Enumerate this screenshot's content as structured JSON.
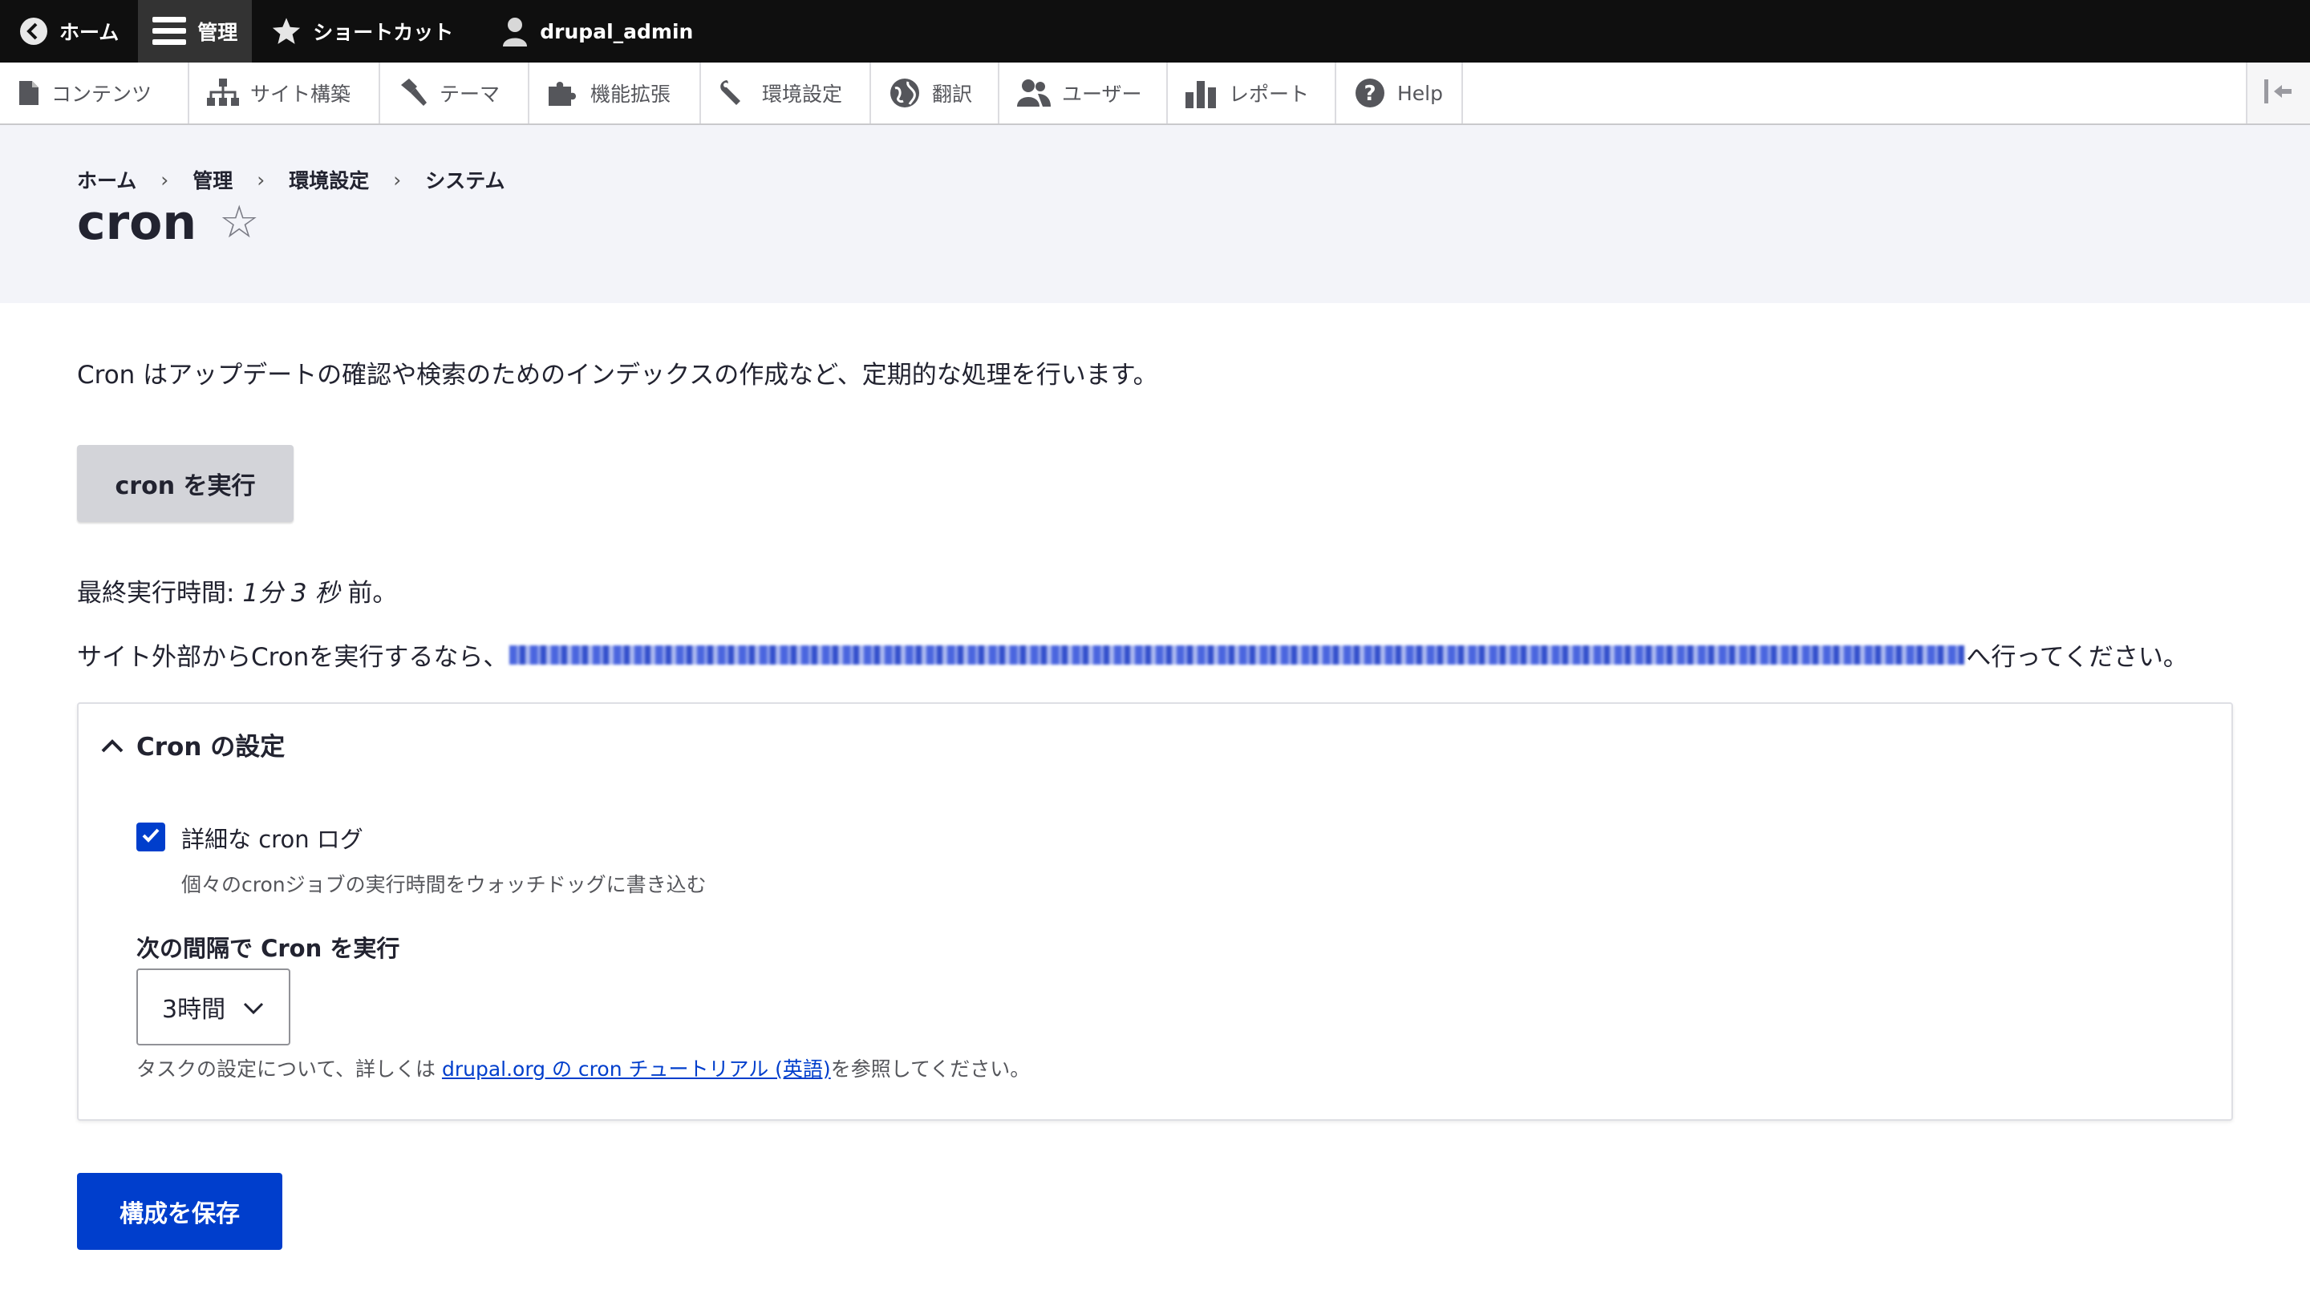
{
  "toolbar": {
    "home": "ホーム",
    "manage": "管理",
    "shortcuts": "ショートカット",
    "user": "drupal_admin"
  },
  "tray": {
    "items": [
      {
        "label": "コンテンツ",
        "icon": "file-icon"
      },
      {
        "label": "サイト構築",
        "icon": "sitemap-icon"
      },
      {
        "label": "テーマ",
        "icon": "paintbrush-icon"
      },
      {
        "label": "機能拡張",
        "icon": "puzzle-icon"
      },
      {
        "label": "環境設定",
        "icon": "wrench-icon"
      },
      {
        "label": "翻訳",
        "icon": "globe-icon"
      },
      {
        "label": "ユーザー",
        "icon": "people-icon"
      },
      {
        "label": "レポート",
        "icon": "bar-chart-icon"
      },
      {
        "label": "Help",
        "icon": "help-icon"
      }
    ]
  },
  "breadcrumb": [
    "ホーム",
    "管理",
    "環境設定",
    "システム"
  ],
  "page": {
    "title": "cron"
  },
  "main": {
    "description": "Cron はアップデートの確認や検索のためのインデックスの作成など、定期的な処理を行います。",
    "run_button": "cron を実行",
    "last_run_prefix": "最終実行時間: ",
    "last_run_value": "1分 3 秒",
    "last_run_suffix": " 前。",
    "external_prefix": "サイト外部からCronを実行するなら、",
    "external_suffix": "へ行ってください。"
  },
  "details": {
    "summary": "Cron の設定",
    "checkbox_label": "詳細な cron ログ",
    "checkbox_checked": true,
    "checkbox_description": "個々のcronジョブの実行時間をウォッチドッグに書き込む",
    "interval_label": "次の間隔で Cron を実行",
    "interval_value": "3時間",
    "help_prefix": "タスクの設定について、詳しくは ",
    "help_link": "drupal.org の cron チュートリアル (英語)",
    "help_suffix": "を参照してください。"
  },
  "actions": {
    "save": "構成を保存"
  },
  "colors": {
    "primary": "#003ecc",
    "toolbar_bg": "#0f0f0f",
    "header_bg": "#f3f4f9"
  }
}
